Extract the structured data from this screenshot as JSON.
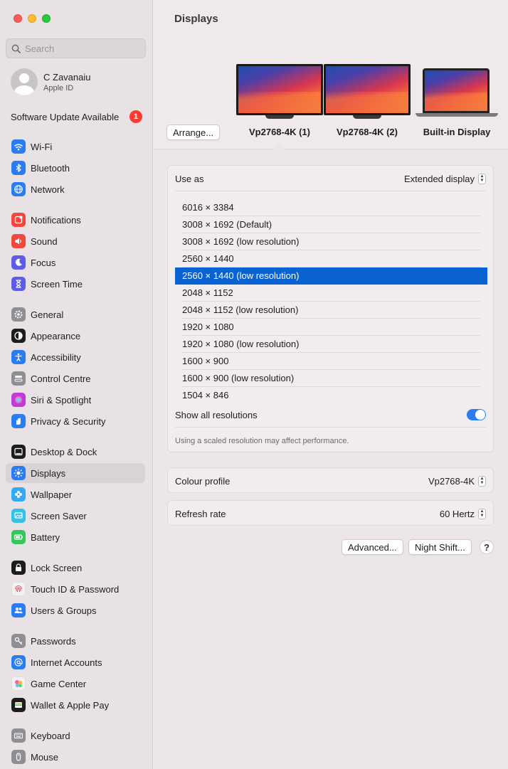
{
  "sidebar": {
    "search_placeholder": "Search",
    "profile": {
      "name": "C Zavanaiu",
      "subtitle": "Apple ID"
    },
    "update": {
      "label": "Software Update Available",
      "count": "1"
    },
    "items": [
      {
        "label": "Wi-Fi",
        "icon": "wifi-icon",
        "color": "#2a7cf0"
      },
      {
        "label": "Bluetooth",
        "icon": "bluetooth-icon",
        "color": "#2a7cf0"
      },
      {
        "label": "Network",
        "icon": "globe-icon",
        "color": "#2a7cf0"
      },
      {
        "label": "Notifications",
        "icon": "bell-icon",
        "color": "#f0483e"
      },
      {
        "label": "Sound",
        "icon": "speaker-icon",
        "color": "#f0483e"
      },
      {
        "label": "Focus",
        "icon": "moon-icon",
        "color": "#5e5ce6"
      },
      {
        "label": "Screen Time",
        "icon": "hourglass-icon",
        "color": "#5e5ce6"
      },
      {
        "label": "General",
        "icon": "gear-icon",
        "color": "#8e8e93"
      },
      {
        "label": "Appearance",
        "icon": "appearance-icon",
        "color": "#1d1d1f"
      },
      {
        "label": "Accessibility",
        "icon": "accessibility-icon",
        "color": "#2a7cf0"
      },
      {
        "label": "Control Centre",
        "icon": "control-centre-icon",
        "color": "#8e8e93"
      },
      {
        "label": "Siri & Spotlight",
        "icon": "siri-icon",
        "color": "#c03ad6"
      },
      {
        "label": "Privacy & Security",
        "icon": "hand-icon",
        "color": "#2a7cf0"
      },
      {
        "label": "Desktop & Dock",
        "icon": "dock-icon",
        "color": "#1d1d1f"
      },
      {
        "label": "Displays",
        "icon": "sun-icon",
        "color": "#2a7cf0"
      },
      {
        "label": "Wallpaper",
        "icon": "flower-icon",
        "color": "#35aaf2"
      },
      {
        "label": "Screen Saver",
        "icon": "screen-saver-icon",
        "color": "#35c0e8"
      },
      {
        "label": "Battery",
        "icon": "battery-icon",
        "color": "#34c759"
      },
      {
        "label": "Lock Screen",
        "icon": "lock-icon",
        "color": "#1d1d1f"
      },
      {
        "label": "Touch ID & Password",
        "icon": "fingerprint-icon",
        "color": "#f2f2f2"
      },
      {
        "label": "Users & Groups",
        "icon": "users-icon",
        "color": "#2a7cf0"
      },
      {
        "label": "Passwords",
        "icon": "key-icon",
        "color": "#8e8e93"
      },
      {
        "label": "Internet Accounts",
        "icon": "at-icon",
        "color": "#2a7cf0"
      },
      {
        "label": "Game Center",
        "icon": "game-center-icon",
        "color": "#f2f2f2"
      },
      {
        "label": "Wallet & Apple Pay",
        "icon": "wallet-icon",
        "color": "#1d1d1f"
      },
      {
        "label": "Keyboard",
        "icon": "keyboard-icon",
        "color": "#8e8e93"
      },
      {
        "label": "Mouse",
        "icon": "mouse-icon",
        "color": "#8e8e93"
      }
    ]
  },
  "main": {
    "title": "Displays",
    "arrange_label": "Arrange...",
    "displays": [
      {
        "label": "Vp2768-4K (1)"
      },
      {
        "label": "Vp2768-4K (2)"
      },
      {
        "label": "Built-in Display"
      }
    ],
    "use_as": {
      "label": "Use as",
      "value": "Extended display"
    },
    "resolutions": [
      "6016 × 3384",
      "3008 × 1692 (Default)",
      "3008 × 1692 (low resolution)",
      "2560 × 1440",
      "2560 × 1440 (low resolution)",
      "2048 × 1152",
      "2048 × 1152 (low resolution)",
      "1920 × 1080",
      "1920 × 1080 (low resolution)",
      "1600 × 900",
      "1600 × 900 (low resolution)",
      "1504 × 846"
    ],
    "selected_resolution": "2560 × 1440 (low resolution)",
    "show_all": {
      "label": "Show all resolutions",
      "enabled": true
    },
    "note": "Using a scaled resolution may affect performance.",
    "colour_profile": {
      "label": "Colour profile",
      "value": "Vp2768-4K"
    },
    "refresh_rate": {
      "label": "Refresh rate",
      "value": "60 Hertz"
    },
    "advanced_label": "Advanced...",
    "night_shift_label": "Night Shift...",
    "help_label": "?"
  }
}
